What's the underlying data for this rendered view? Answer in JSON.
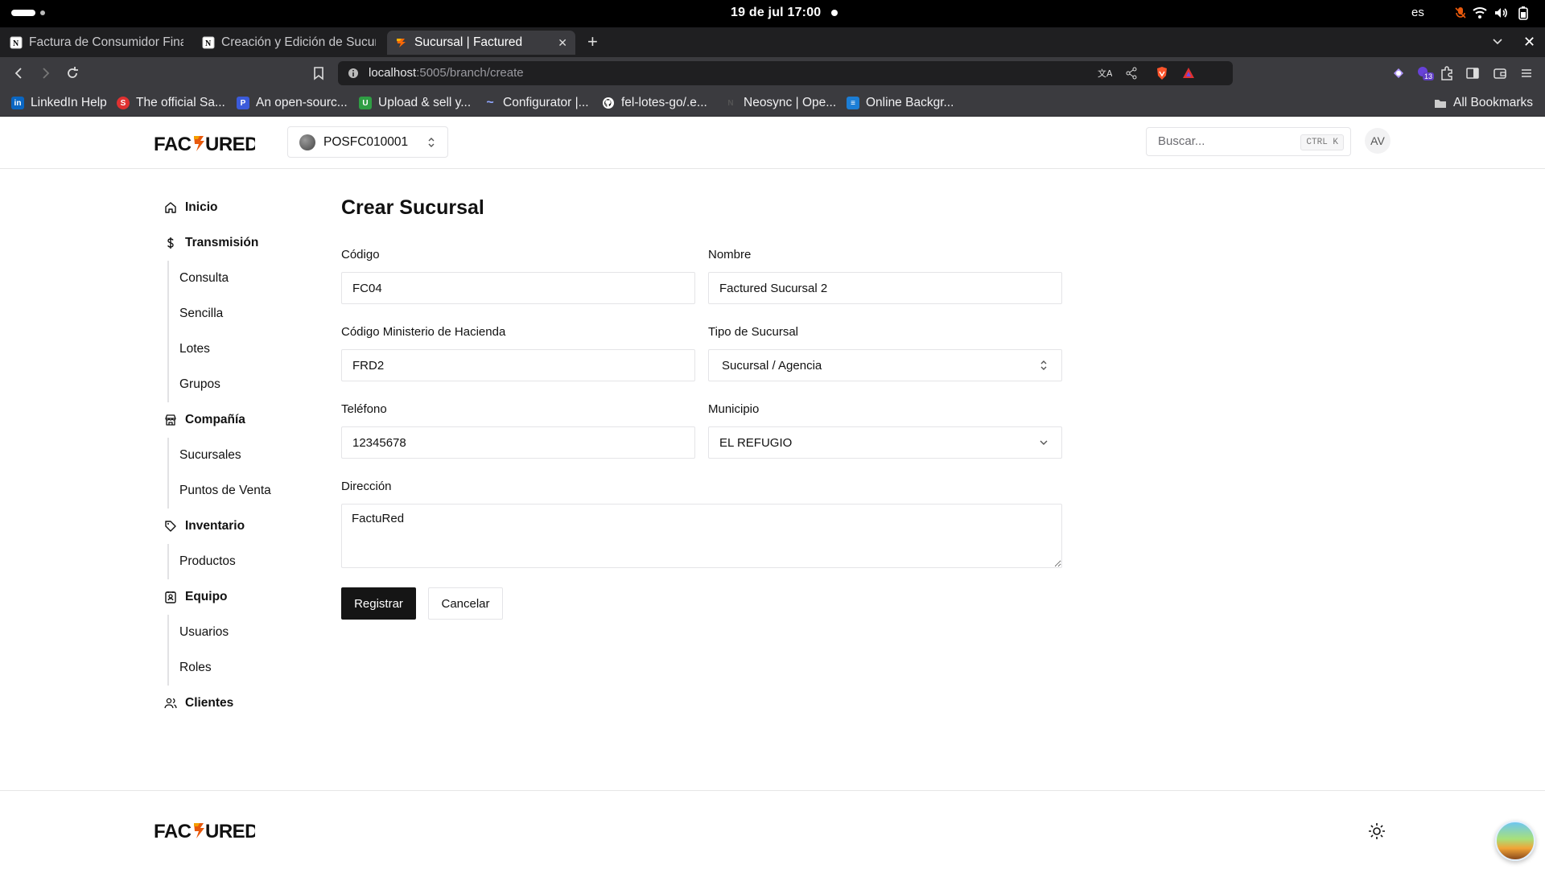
{
  "os": {
    "clock": "19 de jul  17:00",
    "language": "es"
  },
  "browser": {
    "tabs": [
      {
        "title": "Factura de Consumidor Final",
        "favicon": "notion-icon"
      },
      {
        "title": "Creación y Edición de Sucursales",
        "favicon": "notion-icon"
      },
      {
        "title": "Sucursal | Factured",
        "favicon": "factured-icon",
        "active": true
      }
    ],
    "url_host": "localhost",
    "url_path": ":5005/branch/create",
    "bookmarks": [
      {
        "label": "LinkedIn Help",
        "icon": "linkedin-icon",
        "color": "#0a66c2",
        "glyph": "in"
      },
      {
        "label": "The official Sa...",
        "icon": "sanity-icon",
        "color": "#e44",
        "glyph": "S"
      },
      {
        "label": "An open-sourc...",
        "icon": "docs-icon",
        "color": "#3b5bdb",
        "glyph": "P"
      },
      {
        "label": "Upload & sell y...",
        "icon": "upload-icon",
        "color": "#2f9e44",
        "glyph": "U"
      },
      {
        "label": "Configurator |...",
        "icon": "wave-icon",
        "color": "#5c7cfa",
        "glyph": "~"
      },
      {
        "label": "fel-lotes-go/.e...",
        "icon": "github-icon",
        "color": "#222",
        "glyph": "G"
      },
      {
        "label": "Neosync | Ope...",
        "icon": "neosync-icon",
        "color": "#444",
        "glyph": "N"
      },
      {
        "label": "Online Backgr...",
        "icon": "grid-icon",
        "color": "#1c7ed6",
        "glyph": "≡"
      }
    ],
    "all_bookmarks": "All Bookmarks"
  },
  "header": {
    "logo": "FACTURED",
    "pos_code": "POSFC010001",
    "search_placeholder": "Buscar...",
    "search_shortcut": "CTRL K",
    "user_initials": "AV"
  },
  "sidebar": {
    "groups": [
      {
        "label": "Inicio",
        "icon": "home-icon",
        "items": []
      },
      {
        "label": "Transmisión",
        "icon": "dollar-icon",
        "items": [
          "Consulta",
          "Sencilla",
          "Lotes",
          "Grupos"
        ]
      },
      {
        "label": "Compañía",
        "icon": "store-icon",
        "items": [
          "Sucursales",
          "Puntos de Venta"
        ]
      },
      {
        "label": "Inventario",
        "icon": "tag-icon",
        "items": [
          "Productos"
        ]
      },
      {
        "label": "Equipo",
        "icon": "contact-icon",
        "items": [
          "Usuarios",
          "Roles"
        ]
      },
      {
        "label": "Clientes",
        "icon": "users-icon",
        "items": []
      }
    ]
  },
  "form": {
    "title": "Crear Sucursal",
    "codigo": {
      "label": "Código",
      "value": "FC04"
    },
    "nombre": {
      "label": "Nombre",
      "value": "Factured Sucursal 2"
    },
    "codigo_hacienda": {
      "label": "Código Ministerio de Hacienda",
      "value": "FRD2"
    },
    "tipo_sucursal": {
      "label": "Tipo de Sucursal",
      "value": "Sucursal / Agencia"
    },
    "telefono": {
      "label": "Teléfono",
      "value": "12345678"
    },
    "municipio": {
      "label": "Municipio",
      "value": "EL REFUGIO"
    },
    "direccion": {
      "label": "Dirección",
      "value": "FactuRed"
    },
    "submit_label": "Registrar",
    "cancel_label": "Cancelar"
  },
  "footer": {
    "logo": "FACTURED"
  }
}
